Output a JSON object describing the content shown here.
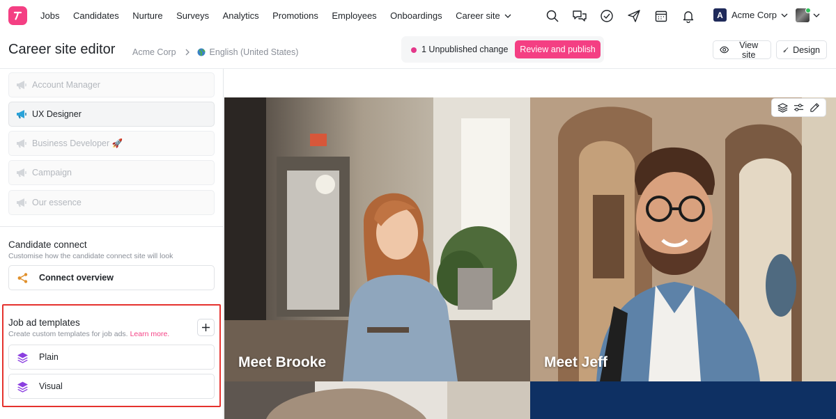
{
  "nav": {
    "items": [
      "Jobs",
      "Candidates",
      "Nurture",
      "Surveys",
      "Analytics",
      "Promotions",
      "Employees",
      "Onboardings",
      "Career site"
    ],
    "company_initial": "A",
    "company_name": "Acme Corp"
  },
  "header": {
    "title": "Career site editor",
    "breadcrumb_company": "Acme Corp",
    "breadcrumb_language": "English (United States)",
    "unpublished_text": "1 Unpublished change",
    "publish_button": "Review and publish",
    "view_site_button": "View site",
    "design_button": "Design"
  },
  "sidebar": {
    "pages": [
      {
        "label": "Account Manager"
      },
      {
        "label": "UX Designer"
      },
      {
        "label": "Business Developer 🚀"
      },
      {
        "label": "Campaign"
      },
      {
        "label": "Our essence"
      }
    ],
    "candidate_connect": {
      "title": "Candidate connect",
      "subtitle": "Customise how the candidate connect site will look",
      "button": "Connect overview"
    },
    "job_ad_templates": {
      "title": "Job ad templates",
      "subtitle": "Create custom templates for job ads.",
      "learn_more": "Learn more.",
      "items": [
        "Plain",
        "Visual"
      ]
    }
  },
  "canvas": {
    "captions": [
      "Meet Brooke",
      "Meet Jeff"
    ]
  },
  "colors": {
    "brand": "#f43f83",
    "highlight": "#e5322d",
    "template_icon": "#8b3fe0",
    "connect_icon": "#e0902c"
  }
}
